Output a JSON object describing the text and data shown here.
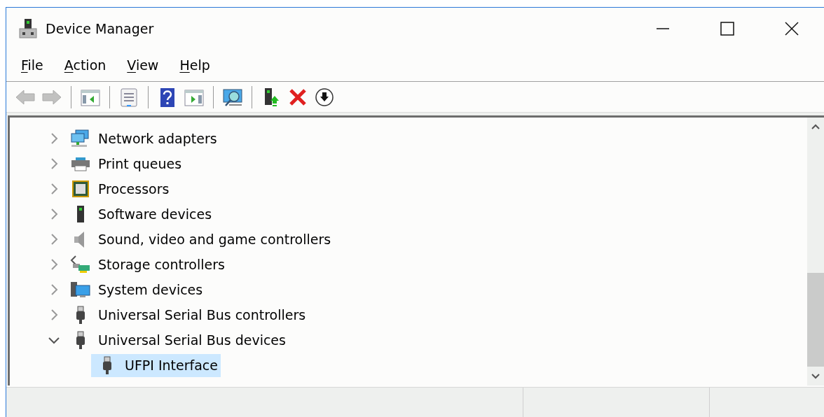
{
  "window": {
    "title": "Device Manager"
  },
  "menu": [
    {
      "label": "File",
      "mnemonic": true
    },
    {
      "label": "Action",
      "mnemonic": true
    },
    {
      "label": "View",
      "mnemonic": true
    },
    {
      "label": "Help",
      "mnemonic": true
    }
  ],
  "toolbar": [
    {
      "kind": "back",
      "disabled": true
    },
    {
      "kind": "forward",
      "disabled": true
    },
    {
      "kind": "separator"
    },
    {
      "kind": "tree-pane",
      "disabled": false
    },
    {
      "kind": "separator"
    },
    {
      "kind": "properties",
      "disabled": false
    },
    {
      "kind": "separator"
    },
    {
      "kind": "help",
      "disabled": false
    },
    {
      "kind": "action-pane",
      "disabled": false
    },
    {
      "kind": "separator"
    },
    {
      "kind": "scan",
      "disabled": false
    },
    {
      "kind": "separator"
    },
    {
      "kind": "update",
      "disabled": false
    },
    {
      "kind": "uninstall",
      "disabled": false
    },
    {
      "kind": "disable",
      "disabled": false
    }
  ],
  "tree": [
    {
      "label": "Network adapters",
      "kind": "network",
      "expanded": false,
      "selected": false
    },
    {
      "label": "Print queues",
      "kind": "printer",
      "expanded": false,
      "selected": false
    },
    {
      "label": "Processors",
      "kind": "cpu",
      "expanded": false,
      "selected": false
    },
    {
      "label": "Software devices",
      "kind": "software",
      "expanded": false,
      "selected": false
    },
    {
      "label": "Sound, video and game controllers",
      "kind": "sound",
      "expanded": false,
      "selected": false
    },
    {
      "label": "Storage controllers",
      "kind": "storage",
      "expanded": false,
      "selected": false
    },
    {
      "label": "System devices",
      "kind": "system",
      "expanded": false,
      "selected": false
    },
    {
      "label": "Universal Serial Bus controllers",
      "kind": "usb",
      "expanded": false,
      "selected": false
    },
    {
      "label": "Universal Serial Bus devices",
      "kind": "usb",
      "expanded": true,
      "selected": false,
      "children": [
        {
          "label": "UFPI Interface",
          "kind": "usb",
          "selected": true
        }
      ]
    }
  ]
}
